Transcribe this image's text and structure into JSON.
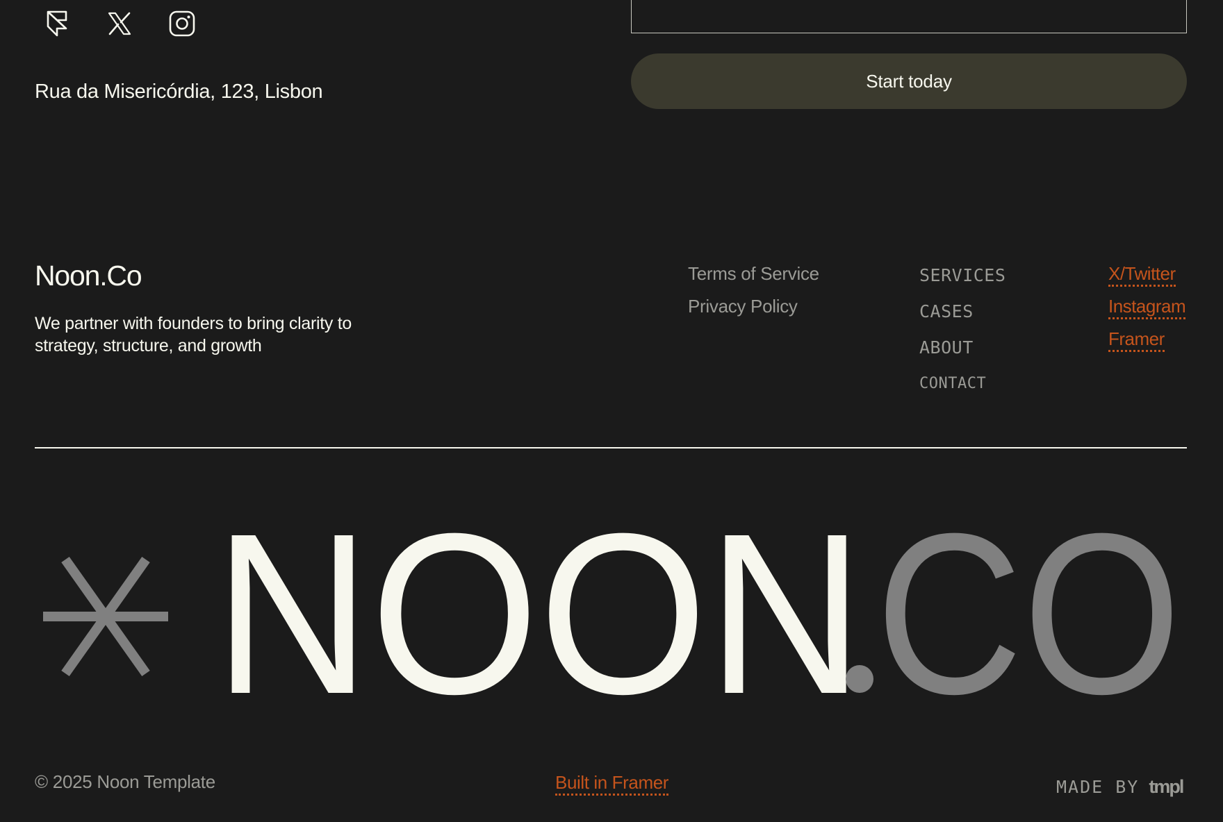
{
  "contact": {
    "social_icons": [
      "framer-icon",
      "x-icon",
      "instagram-icon"
    ],
    "address": "Rua da Misericórdia, 123, Lisbon",
    "cta_label": "Start today"
  },
  "footer": {
    "brand_name": "Noon.Co",
    "tagline": "We partner with founders to bring clarity to strategy, structure, and growth",
    "legal_links": [
      "Terms of Service",
      "Privacy Policy"
    ],
    "nav_links": [
      "SERVICES",
      "CASES",
      "ABOUT",
      "CONTACT"
    ],
    "social_links": [
      "X/Twitter",
      "Instagram",
      "Framer"
    ],
    "big_logo": {
      "word_main": "NOON",
      "word_accent": "CO"
    },
    "copyright": "© 2025 Noon Template",
    "built_in": "Built in Framer",
    "made_by_label": "MADE BY",
    "made_by_brand": "tmpl"
  },
  "colors": {
    "background": "#1b1b1b",
    "primary_text": "#f7f7ee",
    "muted_text": "#9b9b96",
    "accent": "#c5541c",
    "button_bg": "#3b3a2e",
    "logo_muted": "#808080"
  }
}
